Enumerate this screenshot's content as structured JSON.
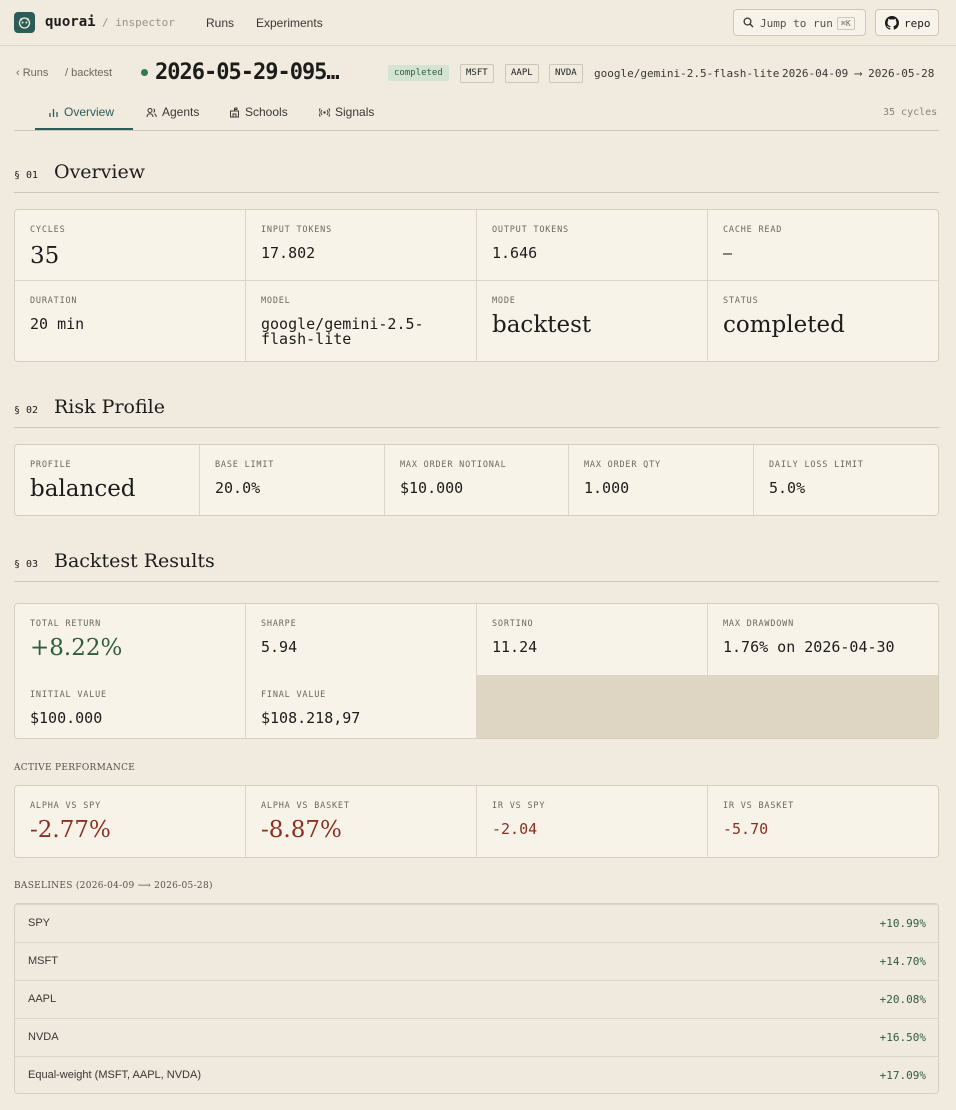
{
  "app": {
    "brand": "quorai",
    "section": "/ inspector",
    "nav": [
      "Runs",
      "Experiments"
    ],
    "jump_label": "Jump to run",
    "jump_kbd": "⌘K",
    "repo_label": "repo"
  },
  "run": {
    "breadcrumb_runs": "‹ Runs",
    "breadcrumb_mode": "/ backtest",
    "title": "2026-05-29-095…",
    "status_badge": "completed",
    "tickers": [
      "MSFT",
      "AAPL",
      "NVDA"
    ],
    "model": "google/gemini-2.5-flash-lite",
    "range": "2026-04-09 ⟶ 2026-05-28"
  },
  "tabs": [
    {
      "label": "Overview",
      "icon": "bar-chart-icon",
      "active": true
    },
    {
      "label": "Agents",
      "icon": "users-icon"
    },
    {
      "label": "Schools",
      "icon": "school-icon"
    },
    {
      "label": "Signals",
      "icon": "signal-icon"
    }
  ],
  "cycles_note": "35 cycles",
  "overview": {
    "num": "§ 01",
    "title": "Overview",
    "cells": [
      {
        "label": "Cycles",
        "value": "35"
      },
      {
        "label": "Input tokens",
        "value": "17.802"
      },
      {
        "label": "Output tokens",
        "value": "1.646"
      },
      {
        "label": "Cache read",
        "value": "—"
      },
      {
        "label": "Duration",
        "value": "20 min"
      },
      {
        "label": "Model",
        "value": "google/gemini-2.5-",
        "value2": "flash-lite"
      },
      {
        "label": "Mode",
        "value": "backtest"
      },
      {
        "label": "Status",
        "value": "completed"
      }
    ]
  },
  "risk": {
    "num": "§ 02",
    "title": "Risk Profile",
    "cells": [
      {
        "label": "Profile",
        "value": "balanced"
      },
      {
        "label": "Base limit",
        "value": "20.0%"
      },
      {
        "label": "Max order notional",
        "value": "$10.000"
      },
      {
        "label": "Max order qty",
        "value": "1.000"
      },
      {
        "label": "Daily loss limit",
        "value": "5.0%"
      }
    ]
  },
  "backtest": {
    "num": "§ 03",
    "title": "Backtest Results",
    "cells": [
      {
        "label": "Total return",
        "value": "+8.22%"
      },
      {
        "label": "Sharpe",
        "value": "5.94"
      },
      {
        "label": "Sortino",
        "value": "11.24"
      },
      {
        "label": "Max drawdown",
        "value": "1.76% on 2026-04-30"
      },
      {
        "label": "Initial value",
        "value": "$100.000"
      },
      {
        "label": "Final value",
        "value": "$108.218,97"
      }
    ]
  },
  "active": {
    "heading": "ACTIVE PERFORMANCE",
    "cells": [
      {
        "label": "Alpha vs SPY",
        "value": "-2.77%"
      },
      {
        "label": "Alpha vs basket",
        "value": "-8.87%"
      },
      {
        "label": "IR vs SPY",
        "value": "-2.04"
      },
      {
        "label": "IR vs basket",
        "value": "-5.70"
      }
    ]
  },
  "baselines": {
    "heading": "BASELINES (2026-04-09 ⟶ 2026-05-28)",
    "rows": [
      {
        "name": "SPY",
        "value": "+10.99%"
      },
      {
        "name": "MSFT",
        "value": "+14.70%"
      },
      {
        "name": "AAPL",
        "value": "+20.08%"
      },
      {
        "name": "NVDA",
        "value": "+16.50%"
      },
      {
        "name": "Equal-weight (MSFT, AAPL, NVDA)",
        "value": "+17.09%"
      }
    ]
  },
  "colors": {
    "accent": "#2c5e57",
    "positive": "#2f5e3c",
    "negative": "#8a3023",
    "background": "#f0eadf"
  }
}
